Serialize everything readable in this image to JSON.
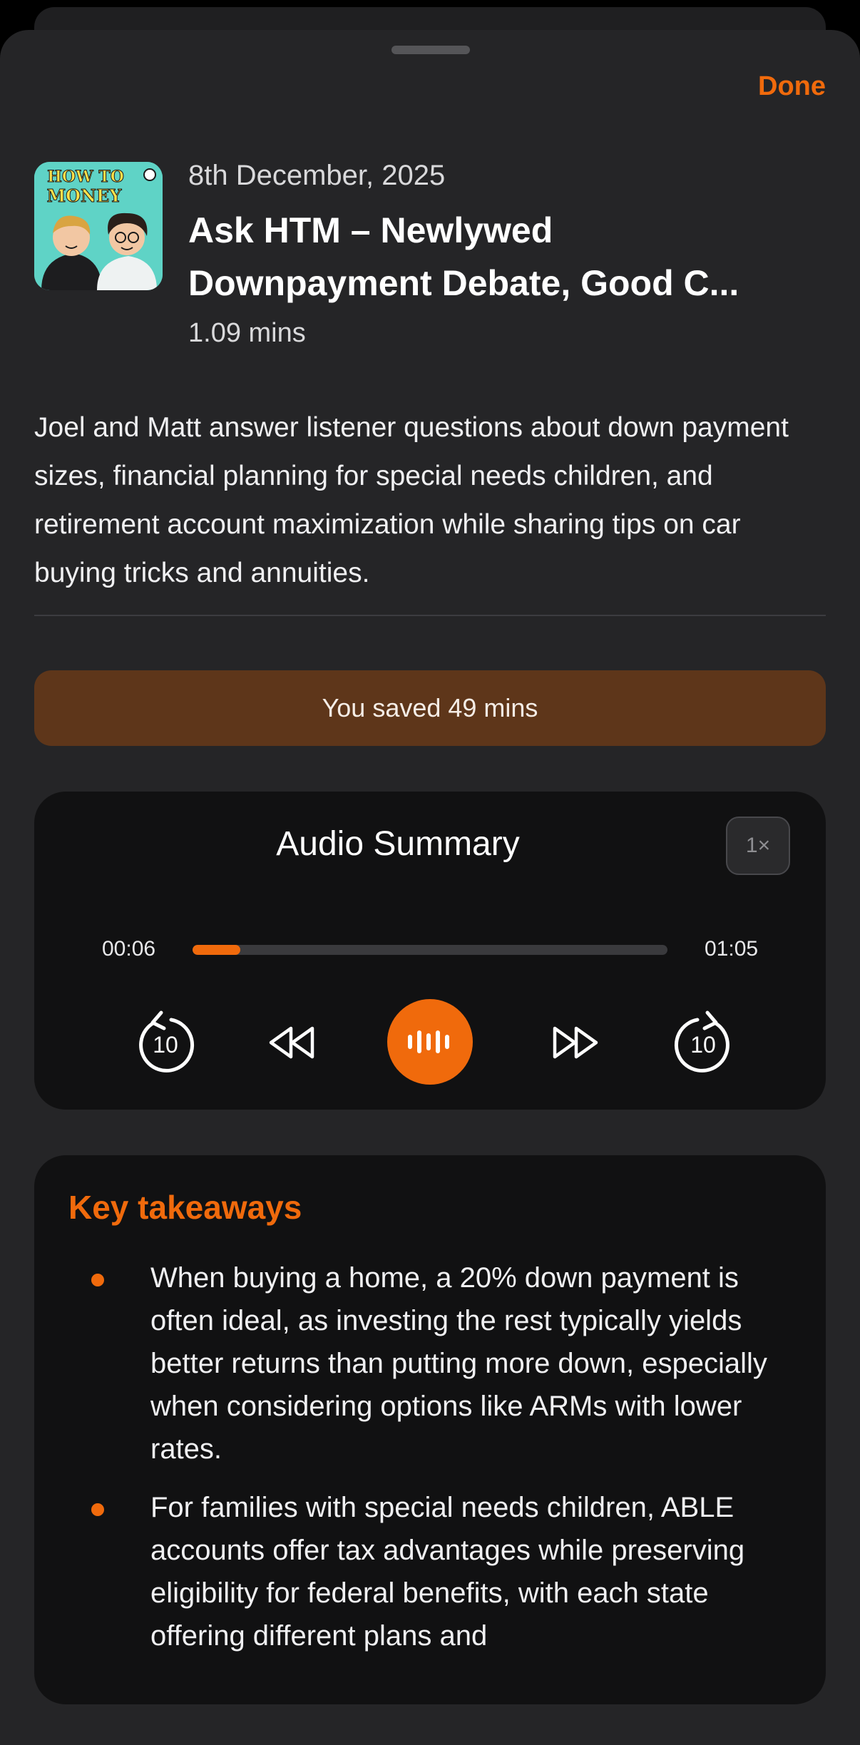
{
  "header": {
    "done_label": "Done"
  },
  "episode": {
    "artwork_icon": "podcast-artwork-how-to-money",
    "artwork_text": "HOW TO MONEY",
    "date": "8th December, 2025",
    "title_line1": "Ask HTM – Newlywed",
    "title_line2": "Downpayment Debate, Good C...",
    "duration": "1.09 mins",
    "description": "Joel and Matt answer listener questions about down payment sizes, financial planning for special needs children, and retirement account maximization while sharing tips on car buying tricks and annuities."
  },
  "saved_banner": {
    "text": "You saved 49 mins"
  },
  "player": {
    "title": "Audio Summary",
    "speed": "1×",
    "current_time": "00:06",
    "total_time": "01:05",
    "progress": 0.1,
    "controls": {
      "skip_back_label": "10",
      "skip_forward_label": "10",
      "icons": [
        "skip-back-10-icon",
        "rewind-icon",
        "audio-wave-icon",
        "fast-forward-icon",
        "skip-forward-10-icon"
      ]
    },
    "accent_color": "#f06a0c"
  },
  "takeaways": {
    "title": "Key takeaways",
    "items": [
      "When buying a home, a 20% down payment is often ideal, as investing the rest typically yields better returns than putting more down, especially when considering options like ARMs with lower rates.",
      "For families with special needs children, ABLE accounts offer tax advantages while preserving eligibility for federal benefits, with each state offering different plans and"
    ]
  }
}
